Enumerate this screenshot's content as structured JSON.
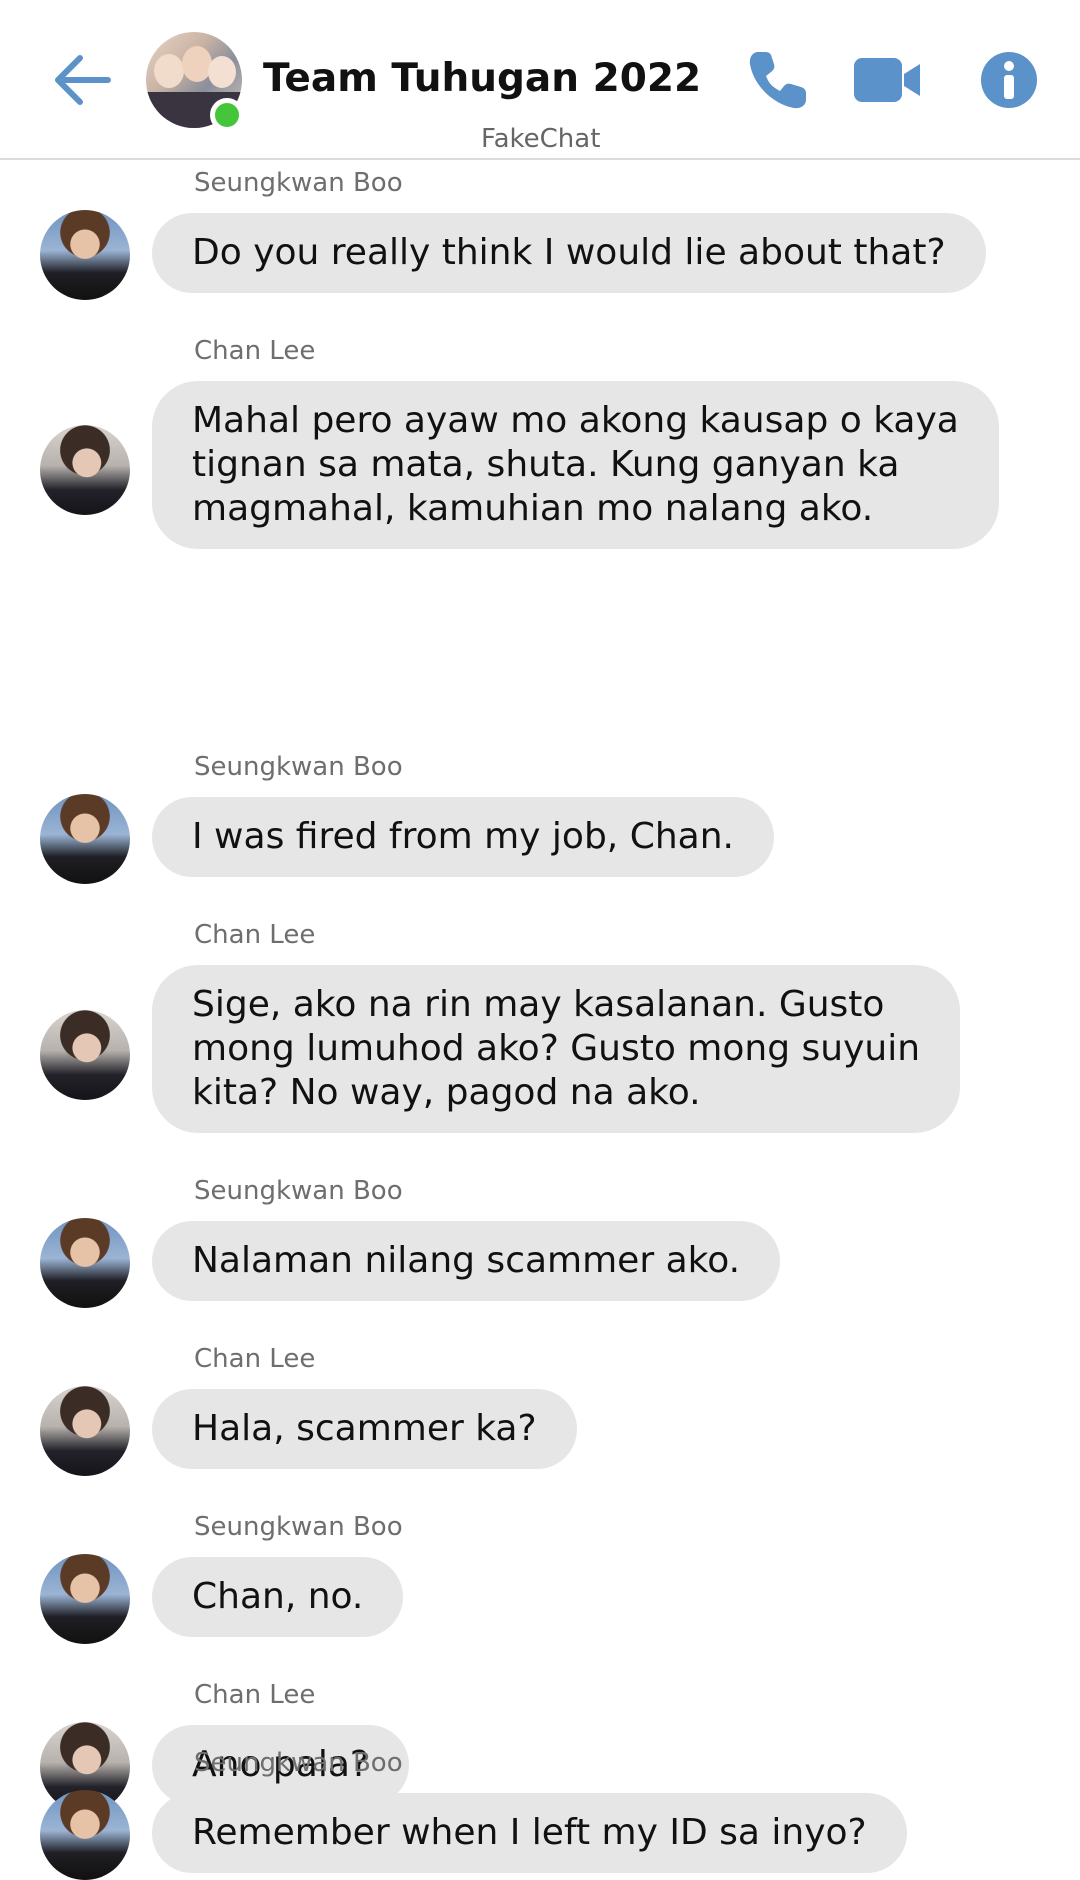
{
  "header": {
    "title": "Team Tuhugan 2022",
    "app_name": "FakeChat",
    "status": "online",
    "accent_color": "#5b92c9"
  },
  "icons": {
    "back": "arrow-left-icon",
    "call": "phone-icon",
    "video": "video-camera-icon",
    "info": "info-icon"
  },
  "messages": [
    {
      "sender": "Seungkwan Boo",
      "text": "Do you really think I would lie about that?"
    },
    {
      "sender": "Chan Lee",
      "text": "Mahal pero ayaw mo akong kausap o kaya\ntignan sa mata, shuta. Kung ganyan ka\nmagmahal, kamuhian mo nalang ako."
    },
    {
      "sender": "Seungkwan Boo",
      "text": "I was fired from my job, Chan."
    },
    {
      "sender": "Chan Lee",
      "text": "Sige, ako na rin may kasalanan. Gusto\nmong lumuhod ako? Gusto mong suyuin\nkita? No way, pagod na ako."
    },
    {
      "sender": "Seungkwan Boo",
      "text": "Nalaman nilang scammer ako."
    },
    {
      "sender": "Chan Lee",
      "text": "Hala, scammer ka?"
    },
    {
      "sender": "Seungkwan Boo",
      "text": "Chan, no."
    },
    {
      "sender": "Chan Lee",
      "text": "Ano pala?"
    },
    {
      "sender": "Seungkwan Boo",
      "text": "Remember when I left my ID sa inyo?"
    }
  ]
}
